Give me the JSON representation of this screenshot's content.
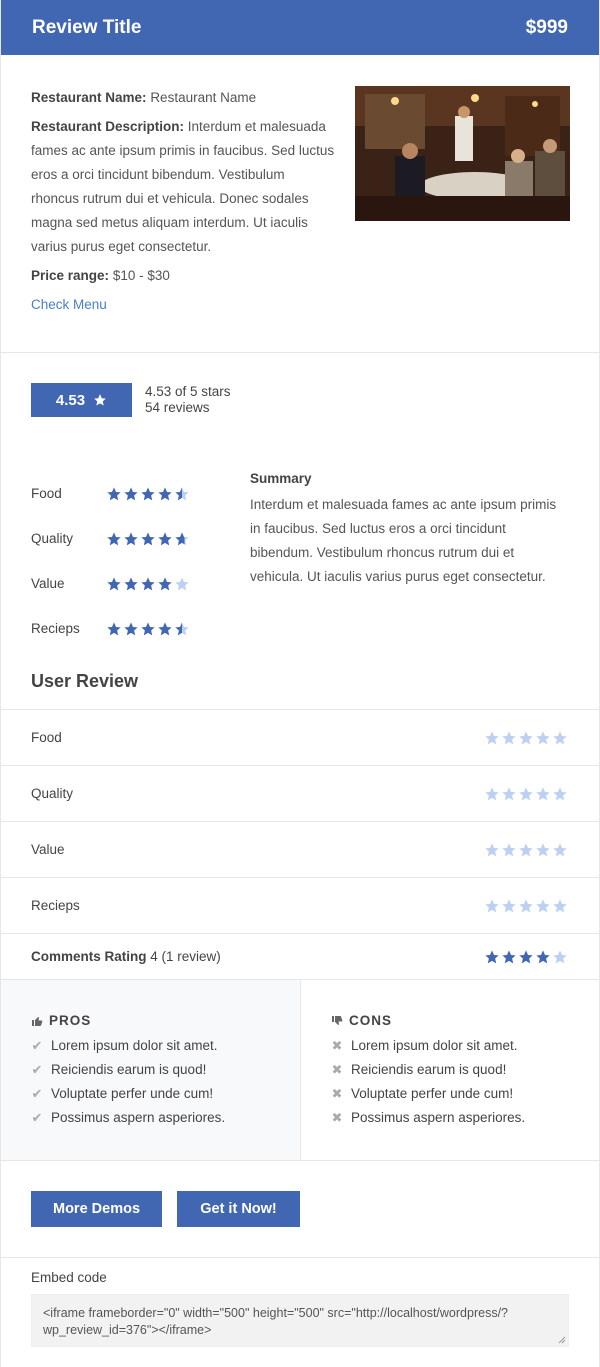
{
  "header": {
    "title": "Review Title",
    "price": "$999"
  },
  "info": {
    "name_label": "Restaurant Name:",
    "name_value": "Restaurant Name",
    "desc_label": "Restaurant Description:",
    "desc_value": "Interdum et malesuada fames ac ante ipsum primis in faucibus. Sed luctus eros a orci tincidunt bibendum. Vestibulum rhoncus rutrum dui et vehicula. Donec sodales magna sed metus aliquam interdum. Ut iaculis varius purus eget consectetur.",
    "price_label": "Price range:",
    "price_value": "$10 - $30",
    "menu_link": "Check Menu"
  },
  "score": {
    "value": "4.53",
    "stars_text": "4.53 of 5 stars",
    "reviews_text": "54 reviews"
  },
  "criteria": [
    {
      "label": "Food",
      "rating": 4.5
    },
    {
      "label": "Quality",
      "rating": 4.7
    },
    {
      "label": "Value",
      "rating": 4
    },
    {
      "label": "Recieps",
      "rating": 4.5
    }
  ],
  "summary": {
    "title": "Summary",
    "text": "Interdum et malesuada fames ac ante ipsum primis in faucibus. Sed luctus eros a orci tincidunt bibendum. Vestibulum rhoncus rutrum dui et vehicula. Ut iaculis varius purus eget consectetur."
  },
  "user_review": {
    "title": "User Review",
    "rows": [
      {
        "label": "Food",
        "rating": 0
      },
      {
        "label": "Quality",
        "rating": 0
      },
      {
        "label": "Value",
        "rating": 0
      },
      {
        "label": "Recieps",
        "rating": 0
      }
    ],
    "comments_label": "Comments Rating",
    "comments_value": "4",
    "comments_count": "(1 review)",
    "comments_rating": 4
  },
  "pros": {
    "title": "PROS",
    "items": [
      "Lorem ipsum dolor sit amet.",
      "Reiciendis earum is quod!",
      "Voluptate perfer unde cum!",
      "Possimus aspern asperiores."
    ]
  },
  "cons": {
    "title": "CONS",
    "items": [
      "Lorem ipsum dolor sit amet.",
      "Reiciendis earum is quod!",
      "Voluptate perfer unde cum!",
      "Possimus aspern asperiores."
    ]
  },
  "buttons": {
    "demos": "More Demos",
    "get": "Get it Now!"
  },
  "embed": {
    "label": "Embed code",
    "code": "<iframe frameborder=\"0\" width=\"500\" height=\"500\" src=\"http://localhost/wordpress/?wp_review_id=376\"></iframe>"
  },
  "colors": {
    "accent": "#4267b2",
    "star_on": "#4267b2",
    "star_off": "#bcd0f2",
    "link": "#4a7fc9"
  }
}
